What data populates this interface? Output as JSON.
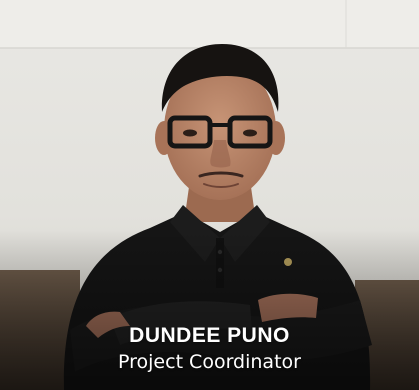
{
  "profile": {
    "name": "DUNDEE PUNO",
    "title": "Project Coordinator",
    "photo_subject": "portrait-photo"
  },
  "colors": {
    "caption_text": "#ffffff",
    "background_wall": "#e7e6e2",
    "shirt": "#151515"
  }
}
